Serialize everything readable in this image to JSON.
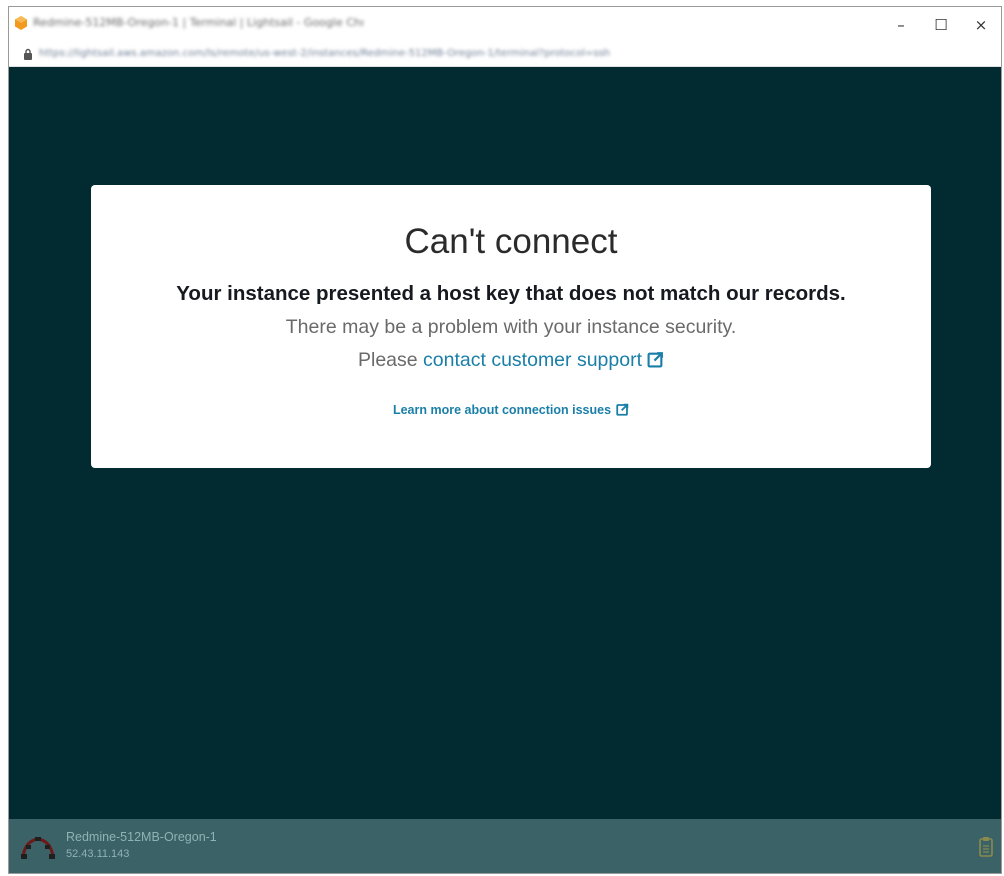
{
  "window": {
    "title": "Redmine-512MB-Oregon-1 | Terminal | Lightsail - Google Chrome",
    "controls": {
      "minimize": "–",
      "maximize": "☐",
      "close": "×"
    }
  },
  "address_bar": {
    "url": "https://lightsail.aws.amazon.com/ls/remote/us-west-2/instances/Redmine-512MB-Oregon-1/terminal?protocol=ssh"
  },
  "dialog": {
    "title": "Can't connect",
    "headline": "Your instance presented a host key that does not match our records.",
    "body": "There may be a problem with your instance security.",
    "support_prefix": "Please",
    "support_link": "contact customer support",
    "learn_more": "Learn more about connection issues"
  },
  "status_bar": {
    "instance_name": "Redmine-512MB-Oregon-1",
    "instance_ip": "52.43.11.143"
  },
  "icons": {
    "app": "lightsail-icon",
    "lock": "lock-icon",
    "external": "external-link-icon",
    "instance_logo": "redmine-logo",
    "clipboard": "clipboard-icon"
  },
  "colors": {
    "terminal_bg": "#012a31",
    "status_bar_bg": "#3b6266",
    "link": "#1a7fa8",
    "app_icon": "#f29a1f"
  }
}
